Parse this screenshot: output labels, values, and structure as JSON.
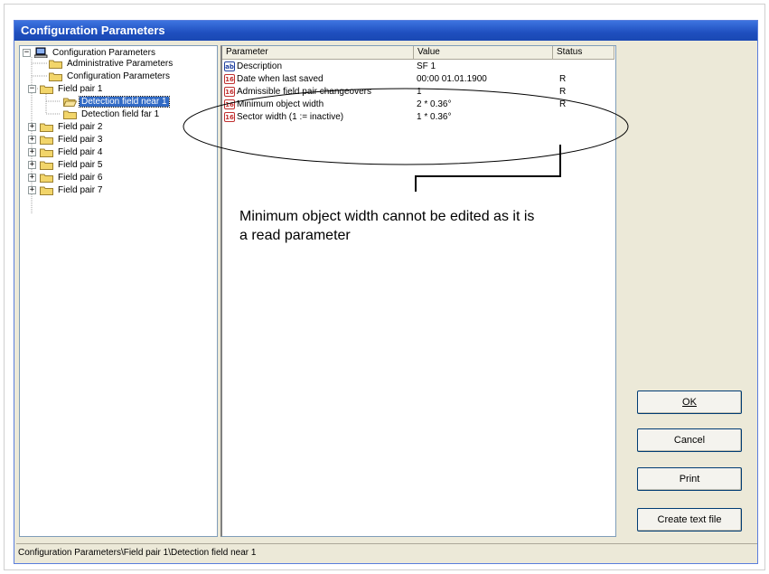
{
  "window": {
    "title": "Configuration Parameters"
  },
  "tree": {
    "root": "Configuration Parameters",
    "items": [
      {
        "label": "Administrative Parameters"
      },
      {
        "label": "Configuration Parameters"
      },
      {
        "label": "Field pair 1"
      },
      {
        "label": "Detection field near 1"
      },
      {
        "label": "Detection field far 1"
      },
      {
        "label": "Field pair 2"
      },
      {
        "label": "Field pair 3"
      },
      {
        "label": "Field pair 4"
      },
      {
        "label": "Field pair 5"
      },
      {
        "label": "Field pair 6"
      },
      {
        "label": "Field pair 7"
      }
    ],
    "expanded_symbol": "−",
    "collapsed_symbol": "+"
  },
  "list": {
    "columns": [
      "Parameter",
      "Value",
      "Status"
    ],
    "rows": [
      {
        "type_icon": "ab",
        "parameter": "Description",
        "value": "SF 1",
        "status": ""
      },
      {
        "type_icon": "16",
        "parameter": "Date when last saved",
        "value": "00:00 01.01.1900",
        "status": "R"
      },
      {
        "type_icon": "16",
        "parameter": "Admissible field pair changeovers",
        "value": "1",
        "status": "R"
      },
      {
        "type_icon": "16",
        "parameter": "Minimum object width",
        "value": "2 * 0.36°",
        "status": "R"
      },
      {
        "type_icon": "16",
        "parameter": "Sector width (1 := inactive)",
        "value": "1 * 0.36°",
        "status": ""
      }
    ]
  },
  "buttons": {
    "ok": "OK",
    "cancel": "Cancel",
    "print": "Print",
    "create_text_file": "Create text file"
  },
  "statusbar": {
    "path": "Configuration Parameters\\Field pair 1\\Detection field near 1"
  },
  "annotation": {
    "line1": "Minimum object width cannot be edited as it is",
    "line2": "a read parameter"
  }
}
